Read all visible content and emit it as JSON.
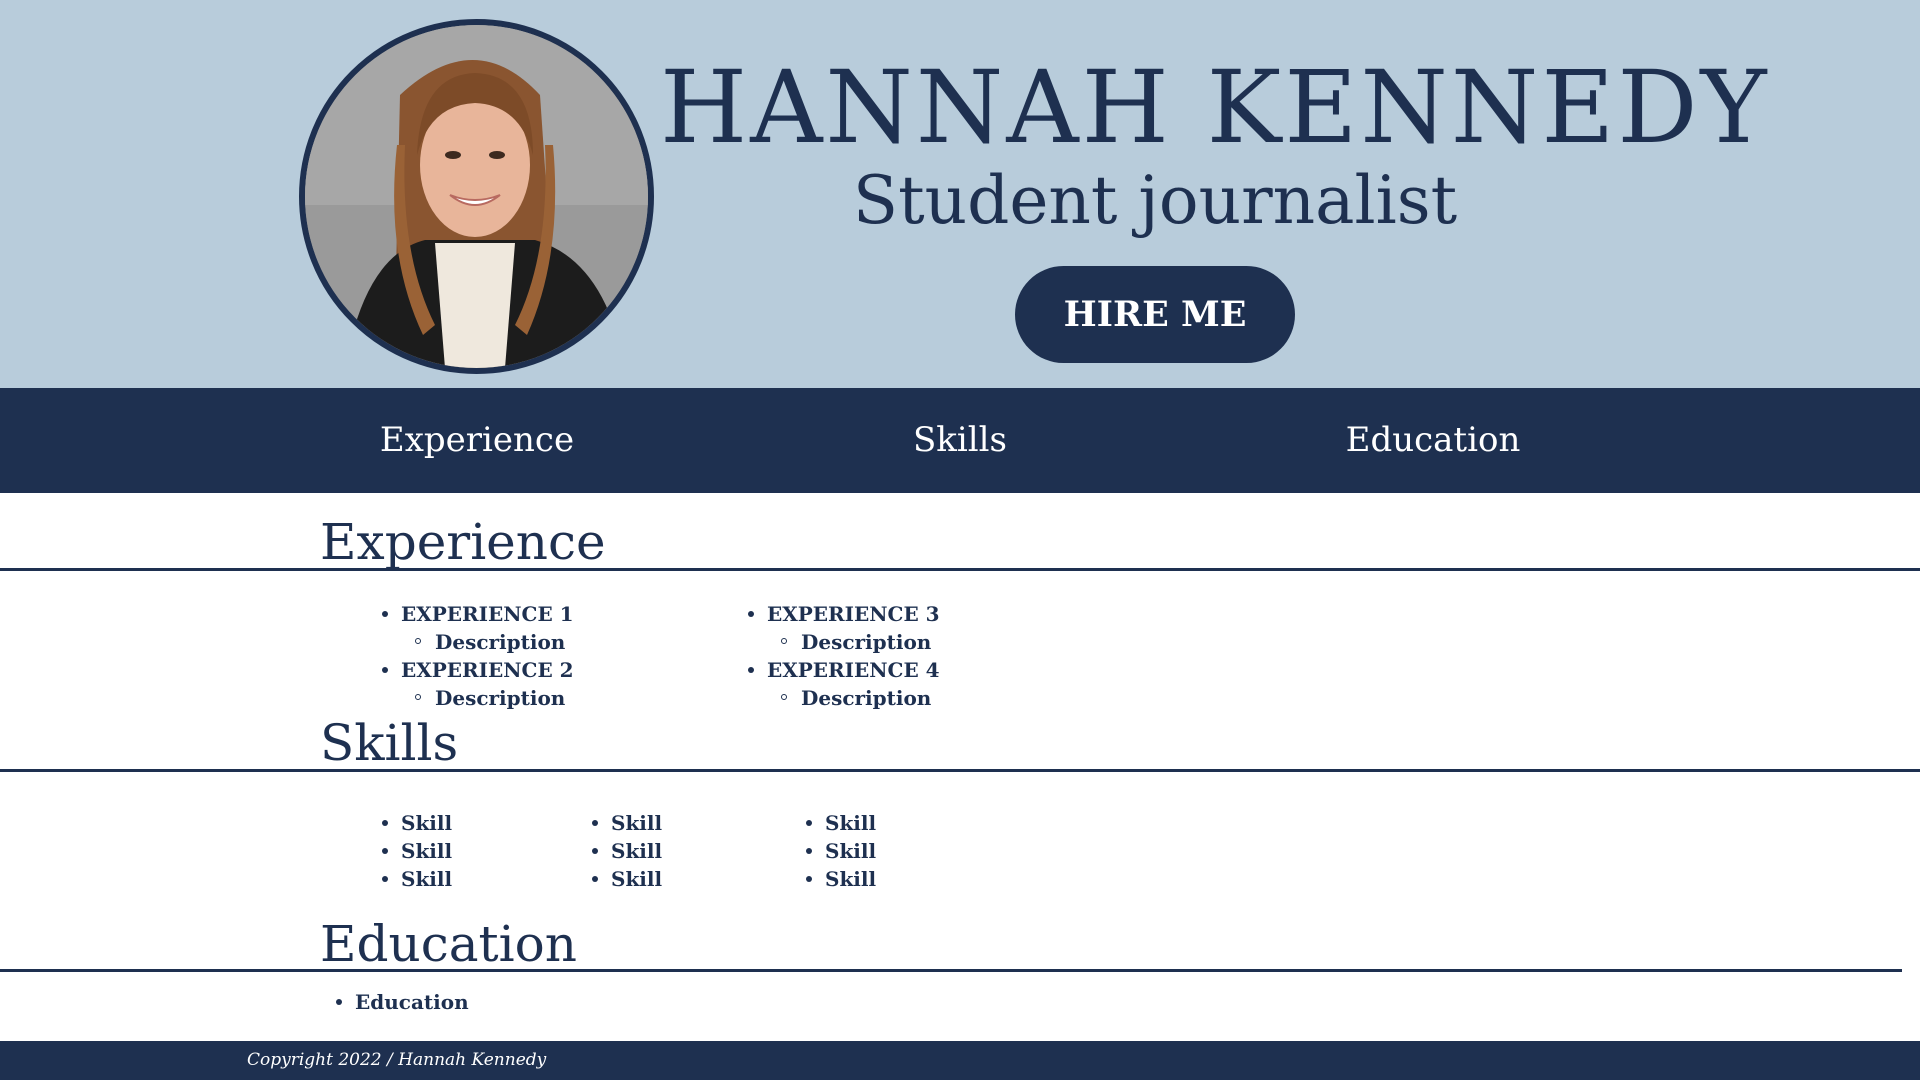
{
  "header": {
    "name": "HANNAH KENNEDY",
    "title": "Student journalist",
    "hire_label": "HIRE ME",
    "photo_alt": "Hannah Kennedy"
  },
  "nav": {
    "items": [
      {
        "label": "Experience"
      },
      {
        "label": "Skills"
      },
      {
        "label": "Education"
      }
    ]
  },
  "experience": {
    "heading": "Experience",
    "columns": [
      [
        {
          "title": "EXPERIENCE 1",
          "description": "Description"
        },
        {
          "title": "EXPERIENCE 2",
          "description": "Description"
        }
      ],
      [
        {
          "title": "EXPERIENCE 3",
          "description": "Description"
        },
        {
          "title": "EXPERIENCE 4",
          "description": "Description"
        }
      ]
    ]
  },
  "skills": {
    "heading": "Skills",
    "columns": [
      [
        "Skill",
        "Skill",
        "Skill"
      ],
      [
        "Skill",
        "Skill",
        "Skill"
      ],
      [
        "Skill",
        "Skill",
        "Skill"
      ]
    ]
  },
  "education": {
    "heading": "Education",
    "items": [
      "Education"
    ]
  },
  "footer": {
    "copyright": "Copyright 2022 / Hannah Kennedy"
  },
  "colors": {
    "navy": "#1e3050",
    "hero_background": "#b8ccdb",
    "page_background": "#ffffff"
  }
}
